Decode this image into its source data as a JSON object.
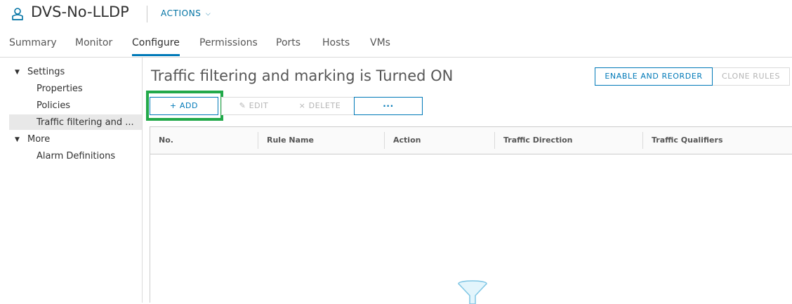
{
  "header": {
    "object_icon": "dvs-network-icon",
    "title": "DVS-No-LLDP",
    "actions_label": "ACTIONS",
    "actions_icon": "chevron-down-icon"
  },
  "tabs": [
    {
      "label": "Summary",
      "active": false
    },
    {
      "label": "Monitor",
      "active": false
    },
    {
      "label": "Configure",
      "active": true
    },
    {
      "label": "Permissions",
      "active": false
    },
    {
      "label": "Ports",
      "active": false
    },
    {
      "label": "Hosts",
      "active": false
    },
    {
      "label": "VMs",
      "active": false
    }
  ],
  "sidebar": {
    "groups": [
      {
        "label": "Settings",
        "expanded": true,
        "items": [
          "Properties",
          "Policies",
          "Traffic filtering and ..."
        ]
      },
      {
        "label": "More",
        "expanded": true,
        "items": [
          "Alarm Definitions"
        ]
      }
    ],
    "selected": "Traffic filtering and ..."
  },
  "main": {
    "title": "Traffic filtering and marking is Turned ON",
    "enable_reorder_label": "ENABLE AND REORDER",
    "clone_rules_label": "CLONE RULES",
    "toolbar": {
      "add_label": "+ ADD",
      "edit_label": "EDIT",
      "delete_label": "DELETE",
      "more_label": "···"
    }
  },
  "table": {
    "columns": [
      "No.",
      "Rule Name",
      "Action",
      "Traffic Direction",
      "Traffic Qualifiers"
    ],
    "rows": []
  },
  "colors": {
    "accent": "#0079b8",
    "highlight_box": "#22a94a"
  }
}
